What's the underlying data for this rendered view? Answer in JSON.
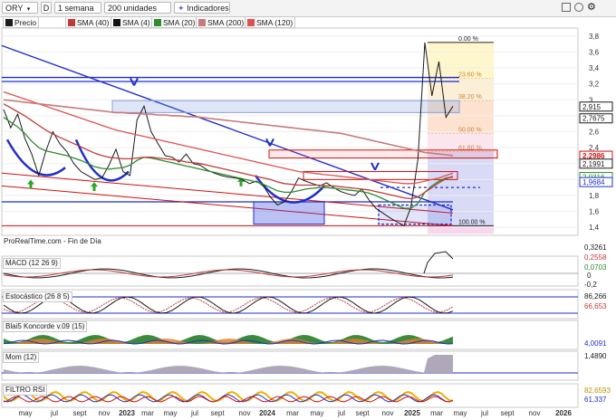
{
  "toolbar": {
    "symbol": "ORY",
    "symbol_icon": "chevron-down-icon",
    "d_label": "D",
    "period": "1 semana",
    "units": "200 unidades",
    "indicators": "Indicadores",
    "window_icons": [
      "grid-icon",
      "clock-icon",
      "settings-icon"
    ]
  },
  "legend": {
    "precio": "Precio",
    "sma40": "SMA (40)",
    "sma4": "SMA (4)",
    "sma20": "SMA (20)",
    "sma200": "SMA (200)",
    "sma120": "SMA (120)"
  },
  "source": "ProRealTime.com - Fin de Día",
  "colors": {
    "price": "#1a1a1a",
    "sma40": "#c03a3a",
    "sma4": "#111111",
    "sma20": "#2e8b2e",
    "sma200": "#c87a7a",
    "sma120": "#e05050",
    "trend_blue": "#1f2ec8",
    "channel_red": "#d01010",
    "fib_yellow": "#fff7cc",
    "fib_orange": "#fde3cf",
    "fib_blue": "#d8daf6",
    "fib_pink": "#f7d6ee"
  },
  "chart_data": {
    "type": "line",
    "title": "",
    "ylim": [
      1.3,
      3.9
    ],
    "yticks": [
      "3,8",
      "3,6",
      "3,4",
      "3,2",
      "3",
      "2,8",
      "2,6",
      "2,4",
      "2,2",
      "2",
      "1,8",
      "1,6",
      "1,4"
    ],
    "xticks": [
      "may",
      "jul",
      "sept",
      "nov",
      "2023",
      "mar",
      "may",
      "jul",
      "sept",
      "nov",
      "2024",
      "mar",
      "may",
      "jul",
      "sept",
      "nov",
      "2025",
      "mar",
      "may",
      "jul",
      "sept",
      "nov",
      "2026"
    ],
    "price_labels": [
      {
        "text": "2,915",
        "color": "#1a1a1a"
      },
      {
        "text": "2,7675",
        "color": "#1a1a1a"
      },
      {
        "text": "2,2986",
        "color": "#d01010"
      },
      {
        "text": "2,1991",
        "color": "#1a1a1a"
      },
      {
        "text": "2,0316",
        "color": "#2e8b2e"
      },
      {
        "text": "1,9684",
        "color": "#1f2ec8"
      }
    ],
    "fib_levels": [
      "0.00 %",
      "23.60 %",
      "38.20 %",
      "50.00 %",
      "61.80 %",
      "100.00 %"
    ],
    "series": [
      {
        "name": "Precio",
        "values": [
          2.88,
          2.65,
          2.82,
          2.52,
          2.32,
          2.05,
          2.35,
          2.6,
          2.45,
          2.35,
          2.2,
          2.1,
          2.05,
          2.0,
          2.02,
          2.18,
          2.38,
          2.1,
          2.05,
          2.75,
          2.92,
          2.6,
          2.45,
          2.3,
          2.28,
          2.22,
          2.32,
          2.2,
          2.18,
          2.12,
          2.08,
          2.05,
          2.03,
          2.02,
          2.0,
          1.95,
          1.98,
          1.92,
          1.78,
          1.68,
          1.72,
          1.85,
          2.02,
          1.98,
          1.95,
          1.92,
          1.96,
          1.9,
          1.85,
          1.82,
          1.8,
          1.88,
          1.75,
          1.64,
          1.58,
          1.52,
          1.47,
          1.42,
          1.65,
          2.25,
          3.72,
          3.05,
          3.48,
          2.78,
          2.92
        ]
      },
      {
        "name": "SMA (20)",
        "values": [
          2.78,
          2.72,
          2.66,
          2.58,
          2.48,
          2.4,
          2.36,
          2.34,
          2.32,
          2.3,
          2.27,
          2.24,
          2.2,
          2.16,
          2.14,
          2.13,
          2.14,
          2.15,
          2.18,
          2.24,
          2.28,
          2.27,
          2.25,
          2.23,
          2.21,
          2.19,
          2.17,
          2.15,
          2.13,
          2.11,
          2.09,
          2.07,
          2.05,
          2.03,
          2.01,
          1.99,
          1.97,
          1.94,
          1.9,
          1.86,
          1.84,
          1.84,
          1.86,
          1.88,
          1.89,
          1.9,
          1.9,
          1.89,
          1.88,
          1.87,
          1.86,
          1.85,
          1.83,
          1.8,
          1.76,
          1.72,
          1.68,
          1.64,
          1.64,
          1.7,
          1.84,
          1.92,
          1.98,
          2.02,
          2.03
        ]
      },
      {
        "name": "SMA (40)",
        "values": [
          2.95,
          2.9,
          2.85,
          2.8,
          2.74,
          2.68,
          2.62,
          2.57,
          2.53,
          2.49,
          2.45,
          2.41,
          2.37,
          2.33,
          2.3,
          2.28,
          2.27,
          2.26,
          2.26,
          2.27,
          2.28,
          2.28,
          2.27,
          2.26,
          2.25,
          2.24,
          2.22,
          2.21,
          2.2,
          2.18,
          2.16,
          2.14,
          2.12,
          2.1,
          2.08,
          2.06,
          2.04,
          2.02,
          2.0,
          1.97,
          1.95,
          1.94,
          1.93,
          1.93,
          1.93,
          1.93,
          1.92,
          1.92,
          1.91,
          1.9,
          1.89,
          1.88,
          1.87,
          1.85,
          1.83,
          1.81,
          1.79,
          1.77,
          1.76,
          1.78,
          1.84,
          1.9,
          1.96,
          2.01,
          2.04
        ]
      },
      {
        "name": "SMA (120)",
        "values": [
          3.1,
          3.07,
          3.04,
          3.01,
          2.98,
          2.95,
          2.92,
          2.89,
          2.86,
          2.83,
          2.8,
          2.77,
          2.74,
          2.71,
          2.68,
          2.65,
          2.62,
          2.6,
          2.58,
          2.56,
          2.54,
          2.52,
          2.5,
          2.48,
          2.46,
          2.44,
          2.42,
          2.4,
          2.38,
          2.36,
          2.34,
          2.32,
          2.3,
          2.28,
          2.26,
          2.24,
          2.22,
          2.2,
          2.18,
          2.16,
          2.14,
          2.12,
          2.1,
          2.09,
          2.08,
          2.07,
          2.06,
          2.05,
          2.04,
          2.03,
          2.02,
          2.01,
          2.0,
          1.99,
          1.98,
          1.97,
          1.96,
          1.95,
          1.95,
          1.96,
          1.98,
          2.0,
          2.02,
          2.05,
          2.08
        ]
      },
      {
        "name": "SMA (200)",
        "values": [
          3.0,
          2.99,
          2.98,
          2.97,
          2.96,
          2.95,
          2.94,
          2.93,
          2.92,
          2.91,
          2.9,
          2.89,
          2.88,
          2.87,
          2.86,
          2.85,
          2.84,
          2.84,
          2.83,
          2.83,
          2.82,
          2.82,
          2.81,
          2.81,
          2.8,
          2.8,
          2.79,
          2.79,
          2.78,
          2.77,
          2.76,
          2.75,
          2.74,
          2.73,
          2.72,
          2.71,
          2.7,
          2.69,
          2.68,
          2.67,
          2.66,
          2.65,
          2.64,
          2.63,
          2.62,
          2.61,
          2.6,
          2.59,
          2.58,
          2.56,
          2.54,
          2.52,
          2.5,
          2.48,
          2.46,
          2.44,
          2.42,
          2.4,
          2.38,
          2.36,
          2.34,
          2.33,
          2.32,
          2.31,
          2.3
        ]
      }
    ],
    "panels": [
      {
        "name": "MACD (12 26 9)",
        "values": [
          "0,3261",
          "0,2558",
          "0,0703"
        ],
        "mid": "0",
        "low": "-0,2"
      },
      {
        "name": "Estocástico (26 8 5)",
        "values": [
          "86,266",
          "66,653"
        ]
      },
      {
        "name": "Blai5 Koncorde v.09 (15)",
        "values": [
          "4,0091"
        ]
      },
      {
        "name": "Mom (12)",
        "values": [
          "1,4890"
        ]
      },
      {
        "name": "FILTRO RSI",
        "values": [
          "82,6593",
          "61,337"
        ]
      }
    ]
  }
}
